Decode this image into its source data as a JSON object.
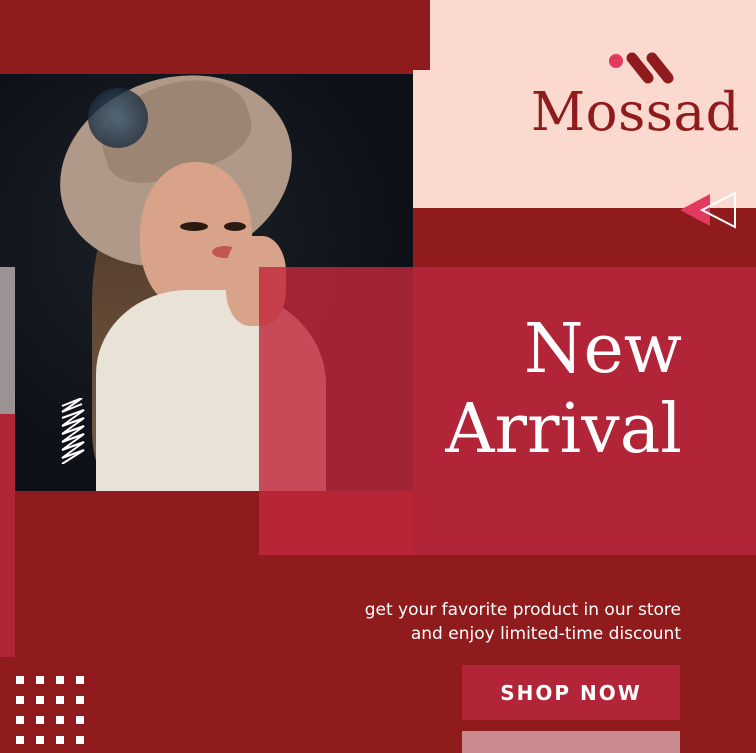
{
  "brand": {
    "name": "Mossad",
    "logo_icon": "brand-dots-icon",
    "accent_color": "#e23a5e"
  },
  "headline": {
    "line1": "New",
    "line2": "Arrival"
  },
  "tagline": {
    "line1": "get your favorite product in our store",
    "line2": "and enjoy limited-time discount"
  },
  "cta": {
    "label": "SHOP NOW"
  },
  "colors": {
    "deep_red": "#8f1b1d",
    "crimson": "#b22437",
    "blush": "#fbd9cf",
    "white": "#ffffff"
  }
}
